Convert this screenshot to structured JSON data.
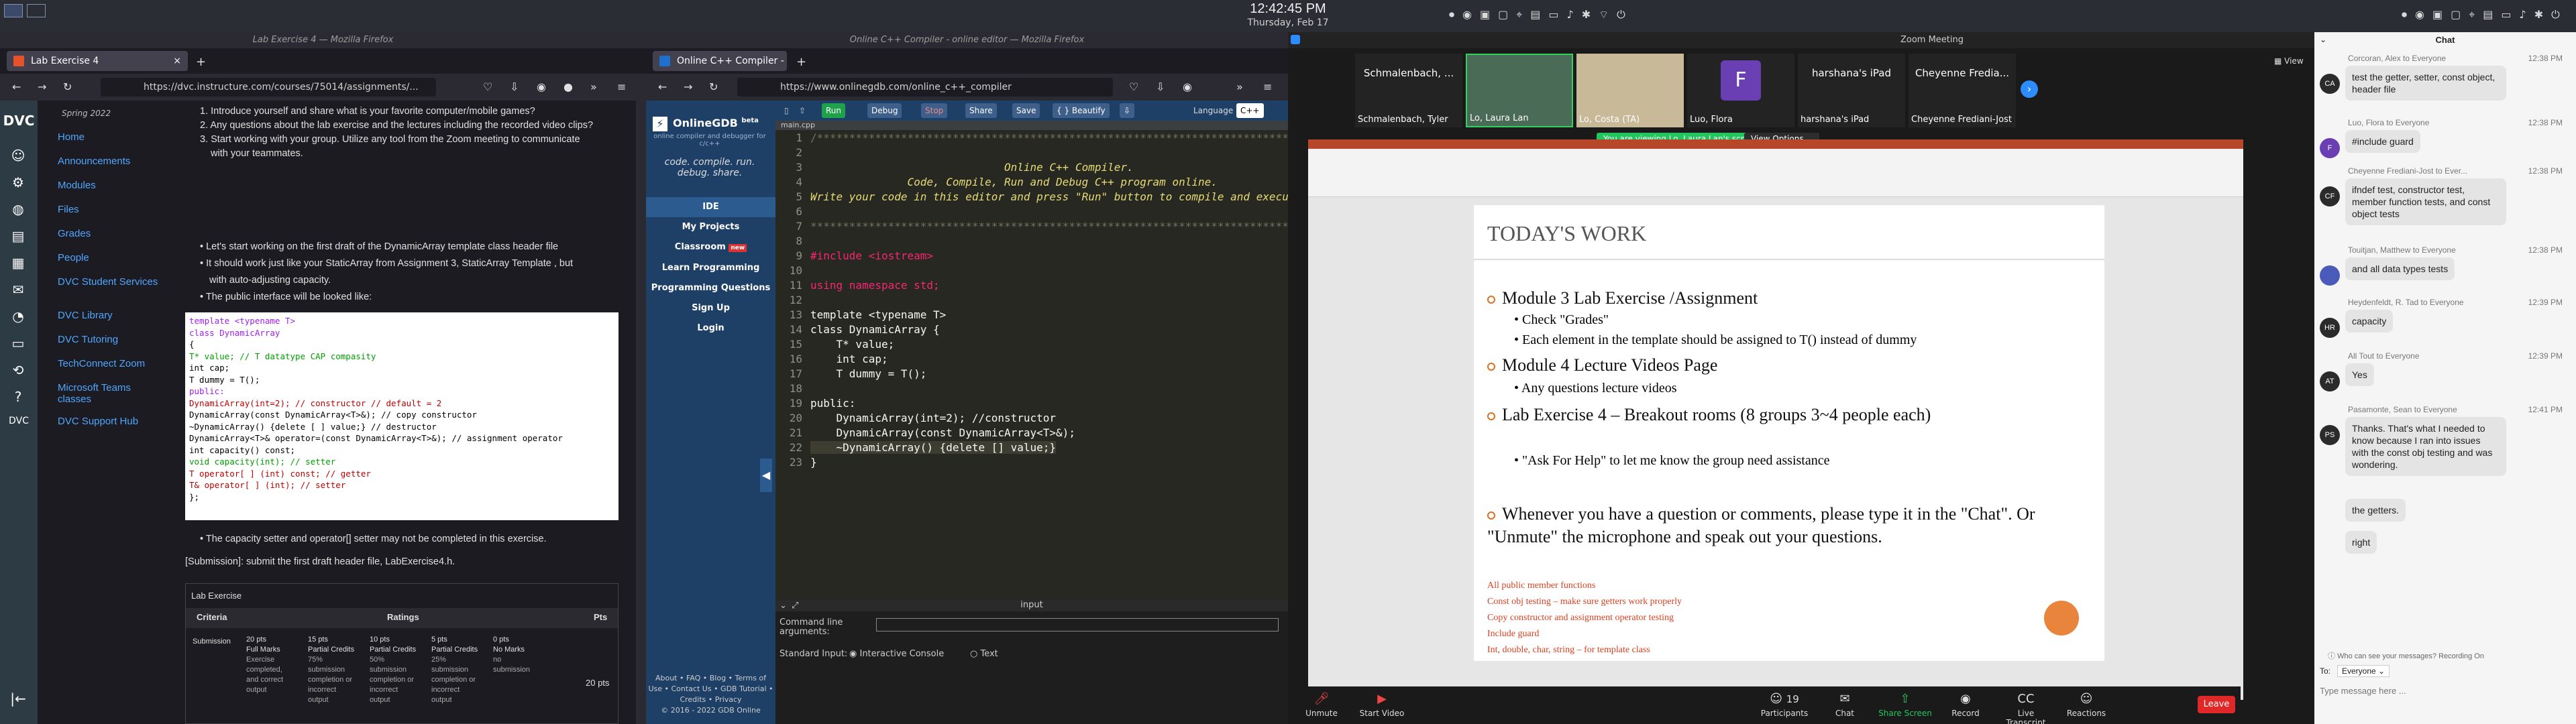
{
  "top_panel": {
    "time": "12:42:45 PM",
    "date": "Thursday, Feb 17"
  },
  "firefox1": {
    "window_title": "Lab Exercise 4 — Mozilla Firefox",
    "tab_label": "Lab Exercise 4",
    "url": "https://dvc.instructure.com/courses/75014/assignments/...",
    "canvas_logo": "DVC",
    "term": "Spring 2022",
    "course_nav": [
      "Home",
      "Announcements",
      "Modules",
      "Files",
      "Grades",
      "People",
      "DVC Student Services",
      "DVC Library",
      "DVC Tutoring",
      "TechConnect Zoom",
      "Microsoft Teams classes",
      "DVC Support Hub"
    ],
    "intro_items": [
      "1. Introduce yourself and share what is your favorite computer/mobile games?",
      "2. Any questions about the lab exercise and the lectures including the recorded video clips?",
      "3. Start working with your group. Utilize any tool from the Zoom meeting to communicate",
      "with your teammates."
    ],
    "bullets": [
      "Let's start working on the first draft of the DynamicArray template class header file",
      "It should work just like your StaticArray from Assignment 3, StaticArray Template , but",
      "with auto-adjusting capacity.",
      "The public interface will be looked like:"
    ],
    "code_lines": [
      "template <typename T>",
      "class DynamicArray",
      "{",
      "  T* value; // T datatype CAP compasity",
      "  int cap;",
      "  T dummy = T();",
      "",
      "  public:",
      "  DynamicArray(int=2); // constructor // default = 2",
      "  DynamicArray(const DynamicArray<T>&); // copy constructor",
      "  ~DynamicArray() {delete [ ] value;} // destructor",
      "  DynamicArray<T>& operator=(const DynamicArray<T>&); // assignment operator",
      "  int capacity() const;",
      "  void capacity(int); // setter",
      "  T operator[ ] (int) const; // getter",
      "  T& operator[ ] (int); // setter",
      "};"
    ],
    "after_code": "The capacity setter and operator[] setter may not be completed in this exercise.",
    "submission": "[Submission]: submit the first draft header file, LabExercise4.h.",
    "rubric": {
      "title": "Lab Exercise",
      "headers": [
        "Criteria",
        "Ratings",
        "Pts"
      ],
      "criteria": "Submission",
      "ratings": [
        [
          "20 pts",
          "Full Marks",
          "Exercise completed, and correct output"
        ],
        [
          "15 pts",
          "Partial Credits",
          "75% submission completion or incorrect output"
        ],
        [
          "10 pts",
          "Partial Credits",
          "50% submission completion or incorrect output"
        ],
        [
          "5 pts",
          "Partial Credits",
          "25% submission completion or incorrect output"
        ],
        [
          "0 pts",
          "No Marks",
          "no submission"
        ]
      ],
      "pts": "20 pts"
    }
  },
  "gdb": {
    "window_title": "Online C++ Compiler - online editor — Mozilla Firefox",
    "tab_label": "Online C++ Compiler - onli...",
    "url": "https://www.onlinegdb.com/online_c++_compiler",
    "buttons": [
      "Run",
      "Debug",
      "Stop",
      "Share",
      "Save",
      "{ } Beautify"
    ],
    "language_label": "Language",
    "language_value": "C++",
    "file_tab": "main.cpp",
    "brand": "OnlineGDB",
    "brand_beta": "beta",
    "tagline": "online compiler and debugger for c/c++",
    "slogan": "code. compile. run. debug. share.",
    "side_links": [
      "IDE",
      "My Projects",
      "Classroom",
      "Learn Programming",
      "Programming Questions",
      "Sign Up",
      "Login"
    ],
    "classroom_badge": "new",
    "footer": [
      "About • FAQ • Blog • Terms of",
      "Use • Contact Us • GDB Tutorial •",
      "Credits • Privacy",
      "© 2016 - 2022 GDB Online"
    ],
    "code": [
      "/******************************************************************************",
      "",
      "                              Online C++ Compiler.",
      "               Code, Compile, Run and Debug C++ program online.",
      "Write your code in this editor and press \"Run\" button to compile and execute it.",
      "",
      "*******************************************************************************/",
      "",
      "#include <iostream>",
      "",
      "using namespace std;",
      "",
      "template <typename T>",
      "class DynamicArray {",
      "    T* value;",
      "    int cap;",
      "    T dummy = T();",
      "",
      "public:",
      "    DynamicArray(int=2); //constructor",
      "    DynamicArray(const DynamicArray<T>&);",
      "    ~DynamicArray() {delete [] value;}",
      "}"
    ],
    "input_label": "input",
    "command_line": "Command line",
    "command_line2": "arguments:",
    "standard_input": "Standard Input:",
    "opt1": "Interactive Console",
    "opt2": "Text"
  },
  "zoom": {
    "title": "Zoom Meeting",
    "view_label": "View",
    "participants": [
      {
        "top": "Schmalenbach, ...",
        "name": "Schmalenbach, Tyler"
      },
      {
        "top": "",
        "name": "Lo, Laura Lan"
      },
      {
        "top": "",
        "name": "Lo, Costa (TA)"
      },
      {
        "top": "F",
        "name": "Luo, Flora"
      },
      {
        "top": "harshana's iPad",
        "name": "harshana's iPad"
      },
      {
        "top": "Cheyenne Fredia...",
        "name": "Cheyenne Frediani-Jost"
      }
    ],
    "viewing_banner": "You are viewing Lo, Laura Lan's screen",
    "view_options": "View Options",
    "slide": {
      "title": "TODAY'S WORK",
      "items": [
        {
          "text": "Module 3 Lab Exercise /Assignment",
          "sub": [
            "Check \"Grades\"",
            "Each element in the template should be assigned to T() instead of dummy"
          ]
        },
        {
          "text": "Module 4 Lecture Videos Page",
          "sub": [
            "Any questions lecture videos"
          ]
        },
        {
          "text": "Lab Exercise 4 – Breakout rooms (8 groups 3~4 people each)",
          "sub": [
            "\"Ask For Help\" to let me know the group need assistance"
          ]
        },
        {
          "text": "Whenever you have a question or comments, please type it in the \"Chat\". Or \"Unmute\" the microphone and speak out your questions.",
          "sub": []
        }
      ],
      "notes": [
        "All public member functions",
        "Const obj testing – make sure getters work properly",
        "Copy constructor and assignment operator testing",
        "Include guard",
        "Int, double, char, string – for template class"
      ]
    },
    "toolbar": [
      "Unmute",
      "Start Video",
      "Participants",
      "Chat",
      "Share Screen",
      "Record",
      "Live Transcript",
      "Reactions"
    ],
    "participant_count": "19",
    "leave": "Leave",
    "chat": {
      "title": "Chat",
      "messages": [
        {
          "from": "Corcoran, Alex to Everyone",
          "time": "12:38 PM",
          "av": "CA",
          "color": "#2b2b2b",
          "text": "test the getter, setter, const object, header file"
        },
        {
          "from": "Luo, Flora to Everyone",
          "time": "12:38 PM",
          "av": "F",
          "color": "#6a3fb4",
          "text": "#include guard"
        },
        {
          "from": "Cheyenne Frediani-Jost to Ever...",
          "time": "12:38 PM",
          "av": "CF",
          "color": "#2b2b2b",
          "text": "ifndef test, constructor test, member function tests, and const object tests"
        },
        {
          "from": "Touitjan, Matthew to Everyone",
          "time": "12:38 PM",
          "av": "",
          "color": "#4a5ab8",
          "text": "and all data types tests"
        },
        {
          "from": "Heydenfeldt, R. Tad to Everyone",
          "time": "12:39 PM",
          "av": "HR",
          "color": "#2b2b2b",
          "text": "capacity"
        },
        {
          "from": "All Tout to Everyone",
          "time": "12:39 PM",
          "av": "AT",
          "color": "#2b2b2b",
          "text": "Yes"
        },
        {
          "from": "Pasamonte, Sean to Everyone",
          "time": "12:41 PM",
          "av": "PS",
          "color": "#2b2b2b",
          "text": "Thanks. That's what I needed to know because I ran into issues with the const obj testing and was wondering."
        },
        {
          "from": "",
          "time": "",
          "av": "",
          "color": "",
          "text": "the getters."
        },
        {
          "from": "",
          "time": "",
          "av": "",
          "color": "",
          "text": "right"
        }
      ],
      "who_can_see": "Who can see your messages? Recording On",
      "to_label": "To:",
      "to_value": "Everyone",
      "placeholder": "Type message here ..."
    }
  }
}
